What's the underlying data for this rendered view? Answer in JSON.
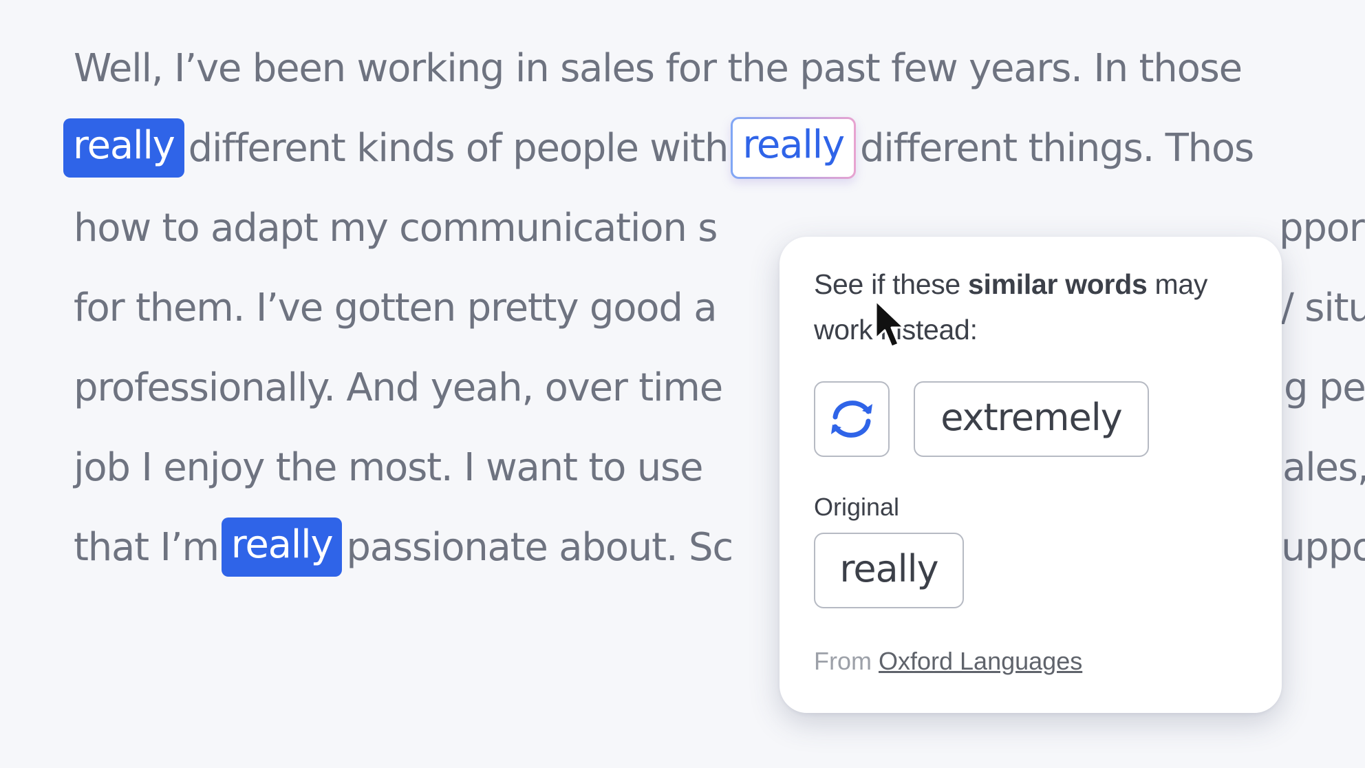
{
  "document": {
    "line1": "Well, I’ve been working in sales for the past few years. In those",
    "line2_highlight": "really",
    "line2_a": "different kinds of people with",
    "line2_focus": "really",
    "line2_b": "different things. Thos",
    "line3_a": "how to adapt my communication s",
    "line3_b": "ppor",
    "line4_a": "for them. I’ve gotten pretty good a",
    "line4_b": "/ situ",
    "line5_a": "professionally. And yeah, over time",
    "line5_b": "g pe",
    "line6_a": "job I enjoy the most. I want to use",
    "line6_b": "ales,",
    "line7_a": "that I’m",
    "line7_highlight": "really",
    "line7_b": "passionate about. Sc",
    "line7_c": "uppo"
  },
  "popover": {
    "intro_prefix": "See if these ",
    "intro_bold": "similar words",
    "intro_suffix": " may work instead:",
    "suggestion": "extremely",
    "original_label": "Original",
    "original_word": "really",
    "source_prefix": "From ",
    "source_link": "Oxford Languages",
    "refresh_icon": "refresh-icon"
  },
  "colors": {
    "accent": "#2f64e8",
    "body_text": "#6e7380",
    "popover_text": "#3c4049",
    "background": "#f6f7fa"
  }
}
